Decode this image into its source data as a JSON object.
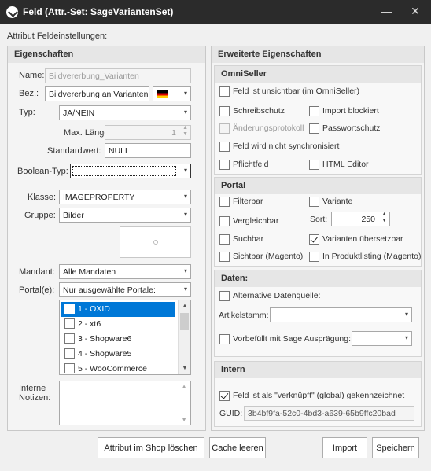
{
  "window": {
    "title": "Feld (Attr.-Set: SageVariantenSet)",
    "minimize": "—",
    "close": "✕"
  },
  "subtitle": "Attribut Feldeinstellungen:",
  "left": {
    "heading": "Eigenschaften",
    "name_label": "Name:",
    "name_value": "Bildvererbung_Varianten",
    "bez_label": "Bez.:",
    "bez_value": "Bildvererbung an Varianten",
    "typ_label": "Typ:",
    "typ_value": "JA/NEIN",
    "maxlen_label": "Max. Länge:",
    "maxlen_value": "1",
    "std_label": "Standardwert:",
    "std_value": "NULL",
    "bool_label": "Boolean-Typ:",
    "bool_value": "",
    "klasse_label": "Klasse:",
    "klasse_value": "IMAGEPROPERTY",
    "gruppe_label": "Gruppe:",
    "gruppe_value": "Bilder",
    "mandant_label": "Mandant:",
    "mandant_value": "Alle Mandaten",
    "portale_label": "Portal(e):",
    "portale_value": "Nur ausgewählte Portale:",
    "portal_items": [
      "1 - OXID",
      "2 - xt6",
      "3 - Shopware6",
      "4 - Shopware5",
      "5 - WooCommerce"
    ],
    "notes_label_1": "Interne",
    "notes_label_2": "Notizen:"
  },
  "right": {
    "heading": "Erweiterte Eigenschaften",
    "omniseller": {
      "heading": "OmniSeller",
      "unsichtbar": "Feld ist unsichtbar (im OmniSeller)",
      "schreibschutz": "Schreibschutz",
      "import_blockiert": "Import blockiert",
      "aenderungsprotokoll": "Änderungsprotokoll",
      "passwortschutz": "Passwortschutz",
      "nicht_sync": "Feld wird nicht synchronisiert",
      "pflichtfeld": "Pflichtfeld",
      "html_editor": "HTML Editor"
    },
    "portal": {
      "heading": "Portal",
      "filterbar": "Filterbar",
      "variante": "Variante",
      "vergleichbar": "Vergleichbar",
      "sort_label": "Sort:",
      "sort_value": "250",
      "suchbar": "Suchbar",
      "varianten_uebersetzbar": "Varianten übersetzbar",
      "sichtbar": "Sichtbar (Magento)",
      "produktlisting": "In Produktlisting (Magento)"
    },
    "daten": {
      "heading": "Daten:",
      "alt_quelle": "Alternative Datenquelle:",
      "artikelstamm_label": "Artikelstamm:",
      "artikelstamm_value": "",
      "vorbefuellt": "Vorbefüllt mit Sage Ausprägung:",
      "vorbefuellt_value": ""
    },
    "intern": {
      "heading": "Intern",
      "verknuepft": "Feld ist als \"verknüpft\" (global) gekennzeichnet",
      "guid_label": "GUID:",
      "guid_value": "3b4bf9fa-52c0-4bd3-a639-65b9ffc20bad"
    }
  },
  "buttons": {
    "delete_in_shop": "Attribut im Shop löschen",
    "clear_cache": "Cache leeren",
    "import": "Import",
    "save": "Speichern"
  }
}
